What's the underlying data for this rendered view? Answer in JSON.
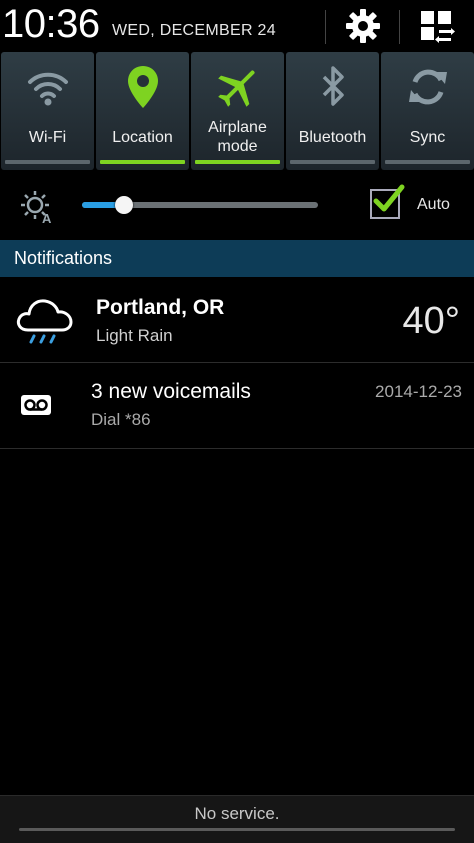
{
  "status": {
    "time": "10:36",
    "date": "WED, DECEMBER 24"
  },
  "header_icons": [
    "gear-icon",
    "grid-edit-icon"
  ],
  "toggles": [
    {
      "label": "Wi-Fi",
      "icon": "wifi-icon",
      "on": false
    },
    {
      "label": "Location",
      "icon": "location-pin-icon",
      "on": true
    },
    {
      "label": "Airplane\nmode",
      "icon": "airplane-icon",
      "on": true
    },
    {
      "label": "Bluetooth",
      "icon": "bluetooth-icon",
      "on": false
    },
    {
      "label": "Sync",
      "icon": "sync-icon",
      "on": false
    }
  ],
  "brightness": {
    "level": 0.18,
    "auto_label": "Auto",
    "auto_checked": true
  },
  "notifications": {
    "header": "Notifications",
    "weather": {
      "city": "Portland, OR",
      "condition": "Light Rain",
      "temperature": "40°",
      "icon": "rain-cloud-icon"
    },
    "voicemail": {
      "title": "3 new voicemails",
      "subtitle": "Dial *86",
      "date": "2014-12-23",
      "icon": "voicemail-icon"
    }
  },
  "footer": {
    "status": "No service."
  },
  "colors": {
    "accent_green": "#7ed321",
    "notif_header": "#0d3c57",
    "slider_blue": "#2a9ee3",
    "icon_inactive": "#8a9aa3"
  }
}
